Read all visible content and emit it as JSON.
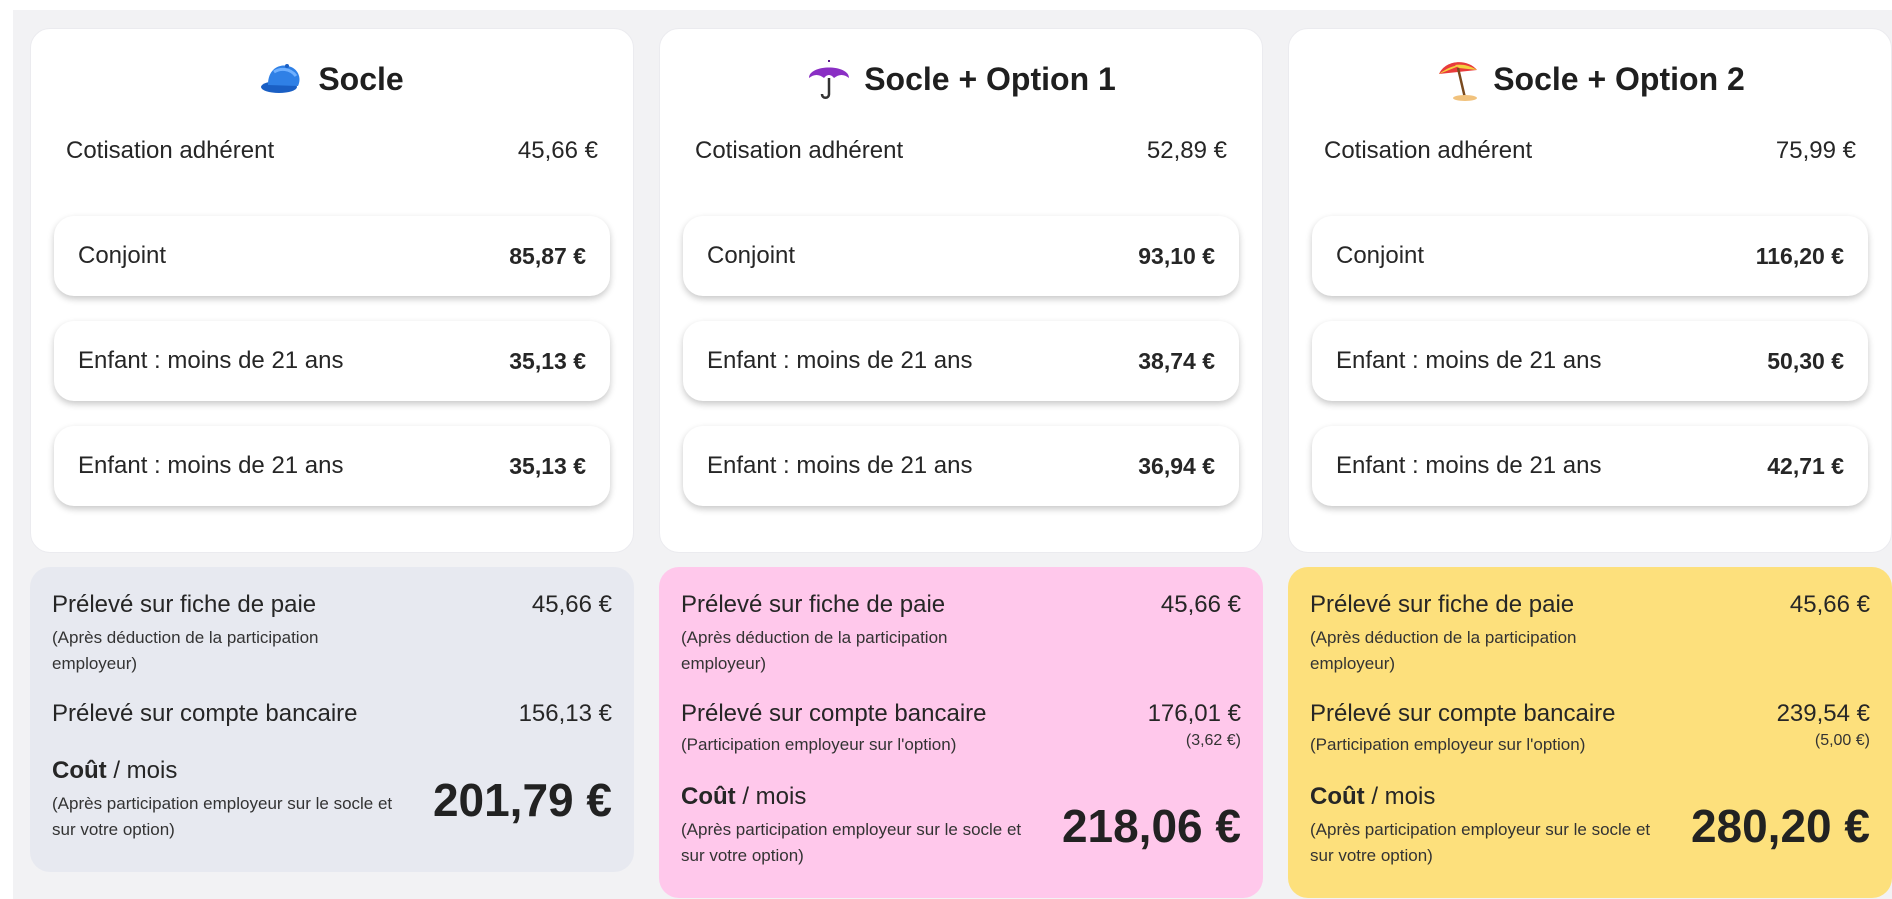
{
  "labels": {
    "cotisation": "Cotisation adhérent",
    "preleve_paie": "Prélevé sur fiche de paie",
    "preleve_paie_note": "(Après déduction de la participation employeur)",
    "preleve_banque": "Prélevé sur compte bancaire",
    "participation_option_note": "(Participation employeur sur l'option)",
    "cout_bold": "Coût",
    "cout_rest": " / mois",
    "cout_note": "(Après participation employeur sur le socle et sur votre option)"
  },
  "plans": [
    {
      "title": "Socle",
      "icon": "cap-icon",
      "cotisation": "45,66 €",
      "members": [
        {
          "label": "Conjoint",
          "amount": "85,87 €"
        },
        {
          "label": "Enfant : moins de 21 ans",
          "amount": "35,13 €"
        },
        {
          "label": "Enfant : moins de 21 ans",
          "amount": "35,13 €"
        }
      ],
      "preleve_paie": "45,66 €",
      "preleve_banque": "156,13 €",
      "total": "201,79 €",
      "bg": "#e7e9f0"
    },
    {
      "title": "Socle + Option 1",
      "icon": "umbrella-icon",
      "cotisation": "52,89 €",
      "members": [
        {
          "label": "Conjoint",
          "amount": "93,10 €"
        },
        {
          "label": "Enfant : moins de 21 ans",
          "amount": "38,74 €"
        },
        {
          "label": "Enfant : moins de 21 ans",
          "amount": "36,94 €"
        }
      ],
      "preleve_paie": "45,66 €",
      "preleve_banque": "176,01 €",
      "participation_option": "(3,62 €)",
      "total": "218,06 €",
      "bg": "#ffc8eb"
    },
    {
      "title": "Socle + Option 2",
      "icon": "beach-umbrella-icon",
      "cotisation": "75,99 €",
      "members": [
        {
          "label": "Conjoint",
          "amount": "116,20 €"
        },
        {
          "label": "Enfant : moins de 21 ans",
          "amount": "50,30 €"
        },
        {
          "label": "Enfant : moins de 21 ans",
          "amount": "42,71 €"
        }
      ],
      "preleve_paie": "45,66 €",
      "preleve_banque": "239,54 €",
      "participation_option": "(5,00 €)",
      "total": "280,20 €",
      "bg": "#fde07c"
    }
  ]
}
